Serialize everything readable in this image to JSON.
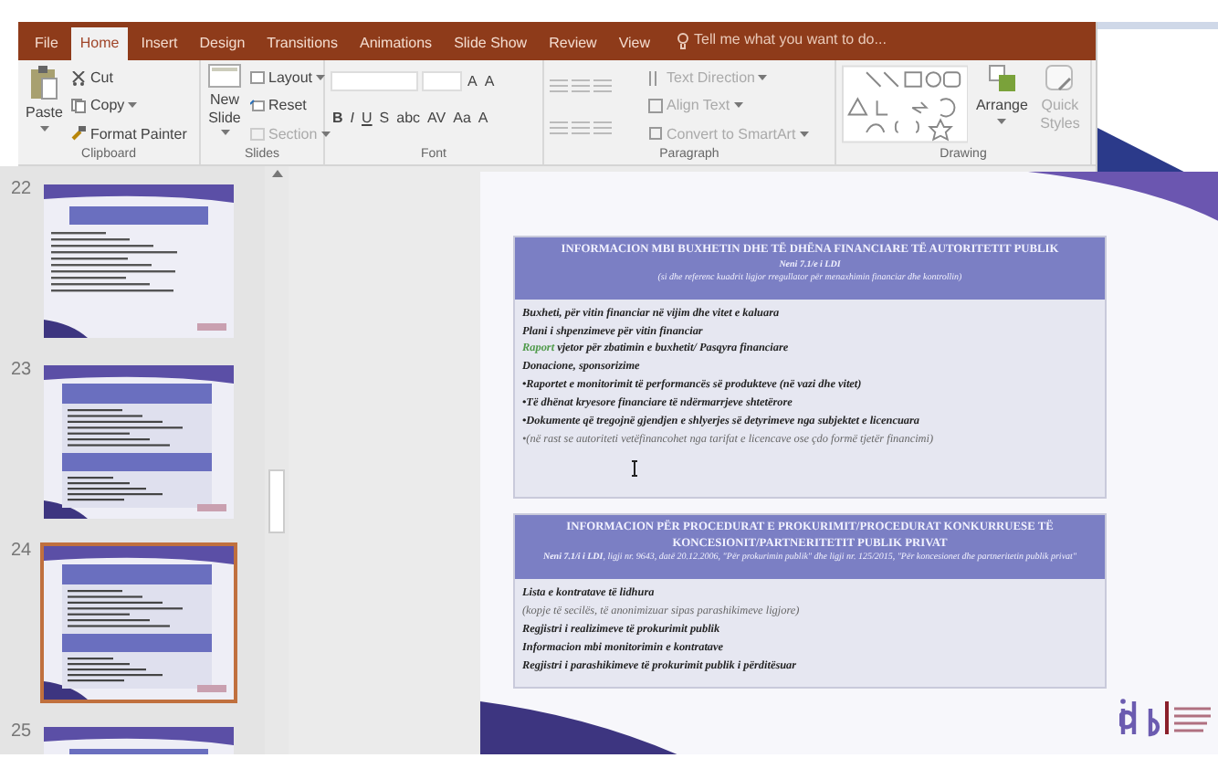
{
  "ribbon": {
    "tabs": [
      {
        "label": "File",
        "selected": false
      },
      {
        "label": "Home",
        "selected": true
      },
      {
        "label": "Insert",
        "selected": false
      },
      {
        "label": "Design",
        "selected": false
      },
      {
        "label": "Transitions",
        "selected": false
      },
      {
        "label": "Animations",
        "selected": false
      },
      {
        "label": "Slide Show",
        "selected": false
      },
      {
        "label": "Review",
        "selected": false
      },
      {
        "label": "View",
        "selected": false
      }
    ],
    "tell_me": "Tell me what you want to do...",
    "clipboard": {
      "label": "Clipboard",
      "paste": "Paste",
      "cut": "Cut",
      "copy": "Copy",
      "format_painter": "Format Painter"
    },
    "slides": {
      "label": "Slides",
      "new_slide": "New Slide",
      "layout": "Layout",
      "reset": "Reset",
      "section": "Section"
    },
    "font": {
      "label": "Font",
      "grow": "A",
      "shrink": "A",
      "buttons": [
        "B",
        "I",
        "U",
        "S",
        "abc",
        "AV",
        "Aa",
        "A"
      ]
    },
    "paragraph": {
      "label": "Paragraph",
      "text_direction": "Text Direction",
      "align_text": "Align Text",
      "convert": "Convert to SmartArt"
    },
    "drawing": {
      "label": "Drawing",
      "arrange": "Arrange",
      "quick_styles": "Quick Styles"
    }
  },
  "thumbnails": [
    {
      "number": "22",
      "selected": false,
      "kind": "single"
    },
    {
      "number": "23",
      "selected": false,
      "kind": "double"
    },
    {
      "number": "24",
      "selected": true,
      "kind": "double"
    },
    {
      "number": "25",
      "selected": false,
      "kind": "single"
    }
  ],
  "slide": {
    "boxes": [
      {
        "title": [
          "INFORMACION MBI BUXHETIN DHE TË DHËNA FINANCIARE TË AUTORITETIT PUBLIK"
        ],
        "subtitles": [
          "**Neni 7.1/e i LDI**",
          "(si dhe referenc kuadrit ligjor rregullator për menaxhimin financiar dhe kontrollin)"
        ],
        "items": [
          {
            "kind": "item",
            "text": "Buxheti, për vitin financiar në vijim dhe vitet e kaluara"
          },
          {
            "kind": "item",
            "text": "Plani i shpenzimeve për vitin financiar"
          },
          {
            "kind": "item",
            "lead": "Raport",
            "text": "vjetor për zbatimin e buxhetit/ Pasqyra financiare"
          },
          {
            "kind": "item",
            "text": "Donacione, sponsorizime"
          },
          {
            "kind": "item",
            "text": "•Raportet e monitorimit të performancës së produkteve (në vazi dhe vitet)"
          },
          {
            "kind": "item",
            "text": "•Të dhënat kryesore financiare të ndërmarrjeve shtetërore"
          },
          {
            "kind": "item",
            "text": "•Dokumente që tregojnë gjendjen e shlyerjes së detyrimeve nga subjektet e licencuara"
          },
          {
            "kind": "note",
            "text": "•(në rast se autoriteti vetëfinancohet nga tarifat e licencave ose çdo formë tjetër financimi)"
          }
        ],
        "cursor": true
      },
      {
        "title": [
          "INFORMACION PËR PROCEDURAT E PROKURIMIT/PROCEDURAT KONKURRUESE TË",
          "KONCESIONIT/PARTNERITETIT PUBLIK PRIVAT"
        ],
        "subtitles": [
          "**Neni 7.1/i i LDI**, ligji nr. 9643, datë 20.12.2006, \"Për prokurimin publik\" dhe ligji nr. 125/2015, \"Për koncesionet dhe partneritetin publik privat\""
        ],
        "items": [
          {
            "kind": "item",
            "text": "Lista e kontratave të lidhura"
          },
          {
            "kind": "note",
            "text": "(kopje të secilës, të anonimizuar sipas parashikimeve ligjore)"
          },
          {
            "kind": "item",
            "text": "Regjistri i realizimeve të prokurimit publik"
          },
          {
            "kind": "item",
            "text": "Informacion mbi monitorimin e kontratave"
          },
          {
            "kind": "item",
            "text": "Regjistri i parashikimeve të prokurimit publik i përditësuar"
          }
        ],
        "cursor": false
      }
    ]
  }
}
